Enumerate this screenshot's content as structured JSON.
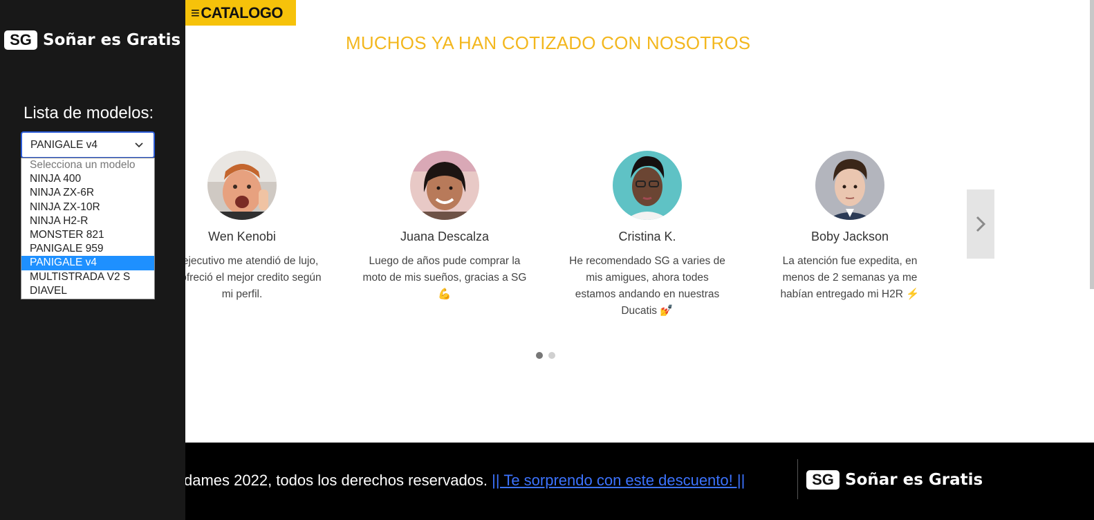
{
  "header": {
    "catalog_icon": "hamburger-icon",
    "catalog_label": "CATALOGO"
  },
  "section": {
    "title": "MUCHOS YA HAN COTIZADO CON NOSOTROS"
  },
  "testimonials": [
    {
      "name": "Wen Kenobi",
      "text": "Un ejecutivo me atendió de lujo, me ofreció el mejor credito según mi perfil."
    },
    {
      "name": "Juana Descalza",
      "text": "Luego de años pude comprar la moto de mis sueños, gracias a SG 💪"
    },
    {
      "name": "Cristina K.",
      "text": "He recomendado SG a varies de mis amigues, ahora todes estamos andando en nuestras Ducatis 💅"
    },
    {
      "name": "Boby Jackson",
      "text": "La atención fue expedita, en menos de 2 semanas ya me habían entregado mi H2R ⚡"
    }
  ],
  "carousel": {
    "next_icon": "chevron-right-icon",
    "pages": 2,
    "active_page": 1
  },
  "sidebar": {
    "logo_badge": "SG",
    "logo_text": "Soñar es Gratis",
    "list_label": "Lista de modelos:",
    "selected_value": "PANIGALE v4",
    "dropdown_icon": "chevron-down-icon",
    "options": [
      "Selecciona un modelo",
      "NINJA 400",
      "NINJA ZX-6R",
      "NINJA ZX-10R",
      "NINJA H2-R",
      "MONSTER 821",
      "PANIGALE 959",
      "PANIGALE v4",
      "MULTISTRADA V2 S",
      "DIAVEL"
    ]
  },
  "footer": {
    "copyright": "dames 2022, todos los derechos reservados.",
    "promo_link": "|| Te sorprendo con este descuento! ||",
    "logo_badge": "SG",
    "logo_text": "Soñar es Gratis"
  },
  "colors": {
    "accent": "#f6c20a",
    "title": "#f3b71e",
    "sidebar": "#181818",
    "footer": "#000000",
    "link": "#3c73ff",
    "selected_option": "#1e90ff"
  }
}
